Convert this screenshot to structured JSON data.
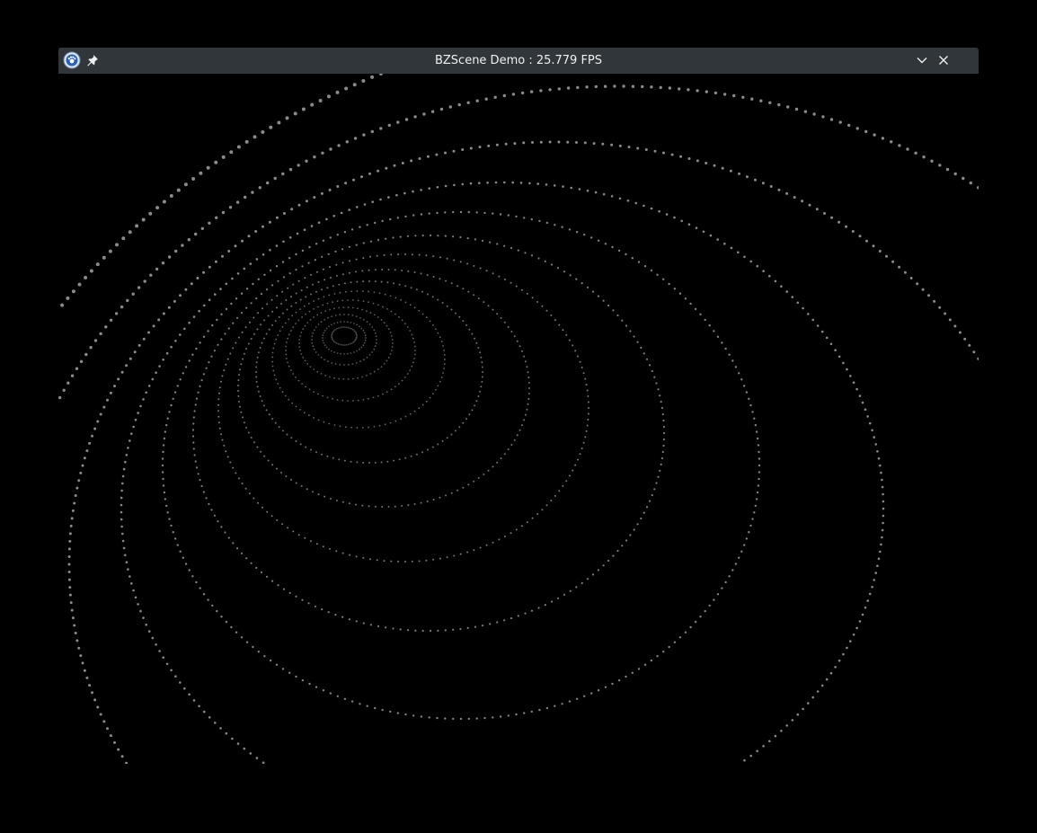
{
  "window": {
    "title": "BZScene Demo : 25.779 FPS"
  },
  "titlebar_icons": {
    "app": "app-icon",
    "pin": "pin-icon",
    "minimize": "chevron-down-icon",
    "close": "close-icon"
  },
  "colors": {
    "titlebar_bg": "#31363b",
    "titlebar_text": "#eff0f1",
    "scene_bg": "#000000",
    "dot_color": "#8a8a8a"
  }
}
